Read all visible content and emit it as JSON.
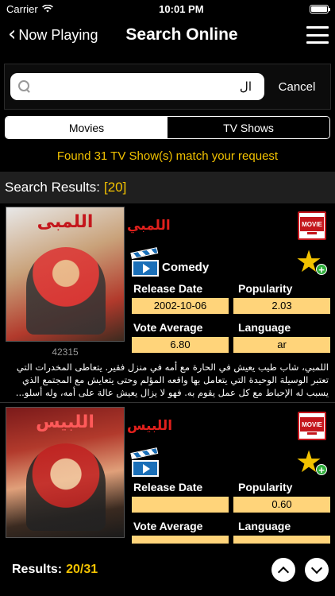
{
  "status_bar": {
    "carrier": "Carrier",
    "time": "10:01 PM"
  },
  "nav": {
    "back_label": "Now Playing",
    "title": "Search Online"
  },
  "search": {
    "value": "ال",
    "cancel_label": "Cancel"
  },
  "segments": {
    "movies": "Movies",
    "tv_shows": "TV Shows",
    "selected": "Movies"
  },
  "found_message": "Found 31 TV Show(s) match your request",
  "results_header": {
    "label": "Search Results:",
    "count": "[20]"
  },
  "field_labels": {
    "release_date": "Release Date",
    "popularity": "Popularity",
    "vote_average": "Vote Average",
    "language": "Language"
  },
  "results": [
    {
      "title": "اللمبي",
      "poster_title": "اللمبى",
      "poster_id": "42315",
      "badge": "MOVIE",
      "genre": "Comedy",
      "release_date": "2002-10-06",
      "popularity": "2.03",
      "vote_average": "6.80",
      "language": "ar",
      "description": "اللمبي، شاب طيب يعيش في الحارة مع أمه في منزل فقير. يتعاطى المخدرات التي تعتبر الوسيلة الوحيدة التي يتعامل بها واقعه المؤلم وحتى يتعايش مع المجتمع الذي يسبب له الإحباط مع كل عمل يقوم به. فهو لا يزال يعيش عالة على أمه، وله أسلو..."
    },
    {
      "title": "اللبيس",
      "poster_title": "اللبيس",
      "badge": "MOVIE",
      "genre": "",
      "release_date": "",
      "popularity": "0.60",
      "vote_average": "",
      "language": ""
    }
  ],
  "bottom": {
    "label": "Results:",
    "value": "20/31"
  },
  "colors": {
    "accent": "#f2c200",
    "value_bg": "#ffd47a",
    "title_red": "#e0201c"
  },
  "icons": [
    "wifi-icon",
    "battery-icon",
    "back-chevron-icon",
    "hamburger-menu-icon",
    "search-icon",
    "movie-badge-icon",
    "clapperboard-icon",
    "favorite-star-add-icon",
    "chevron-up-icon",
    "chevron-down-icon"
  ]
}
